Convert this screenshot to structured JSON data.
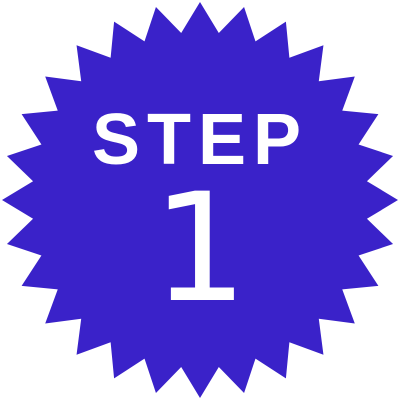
{
  "badge": {
    "label": "STEP",
    "number": "1",
    "fill_color": "#3a22c9",
    "text_color": "#ffffff",
    "shape": "starburst",
    "points": 28
  }
}
